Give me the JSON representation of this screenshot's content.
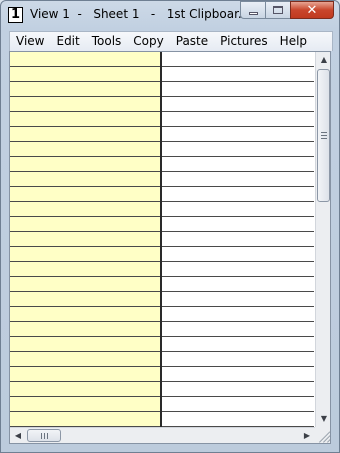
{
  "window": {
    "title": "View 1  -   Sheet 1   -   1st Clipboar...",
    "icon_label": "1",
    "caption_buttons": [
      "minimize",
      "maximize",
      "close"
    ],
    "close_glyph": "✕"
  },
  "menubar": {
    "items": [
      "View",
      "Edit",
      "Tools",
      "Copy",
      "Paste",
      "Pictures",
      "Help"
    ]
  },
  "grid": {
    "columns": [
      {
        "id": "A",
        "fill": "#ffffc6"
      },
      {
        "id": "B",
        "fill": "#ffffff"
      }
    ],
    "visible_rows": 25,
    "cells": []
  },
  "scrollbars": {
    "vertical": {
      "up_arrow": "▲",
      "down_arrow": "▼",
      "grip": "≡"
    },
    "horizontal": {
      "left_arrow": "◀",
      "right_arrow": "▶",
      "grip": "|||"
    }
  },
  "colors": {
    "column_a": "#ffffc6",
    "column_b": "#ffffff",
    "close_button": "#c9462c",
    "chrome": "#c1d0e1"
  }
}
